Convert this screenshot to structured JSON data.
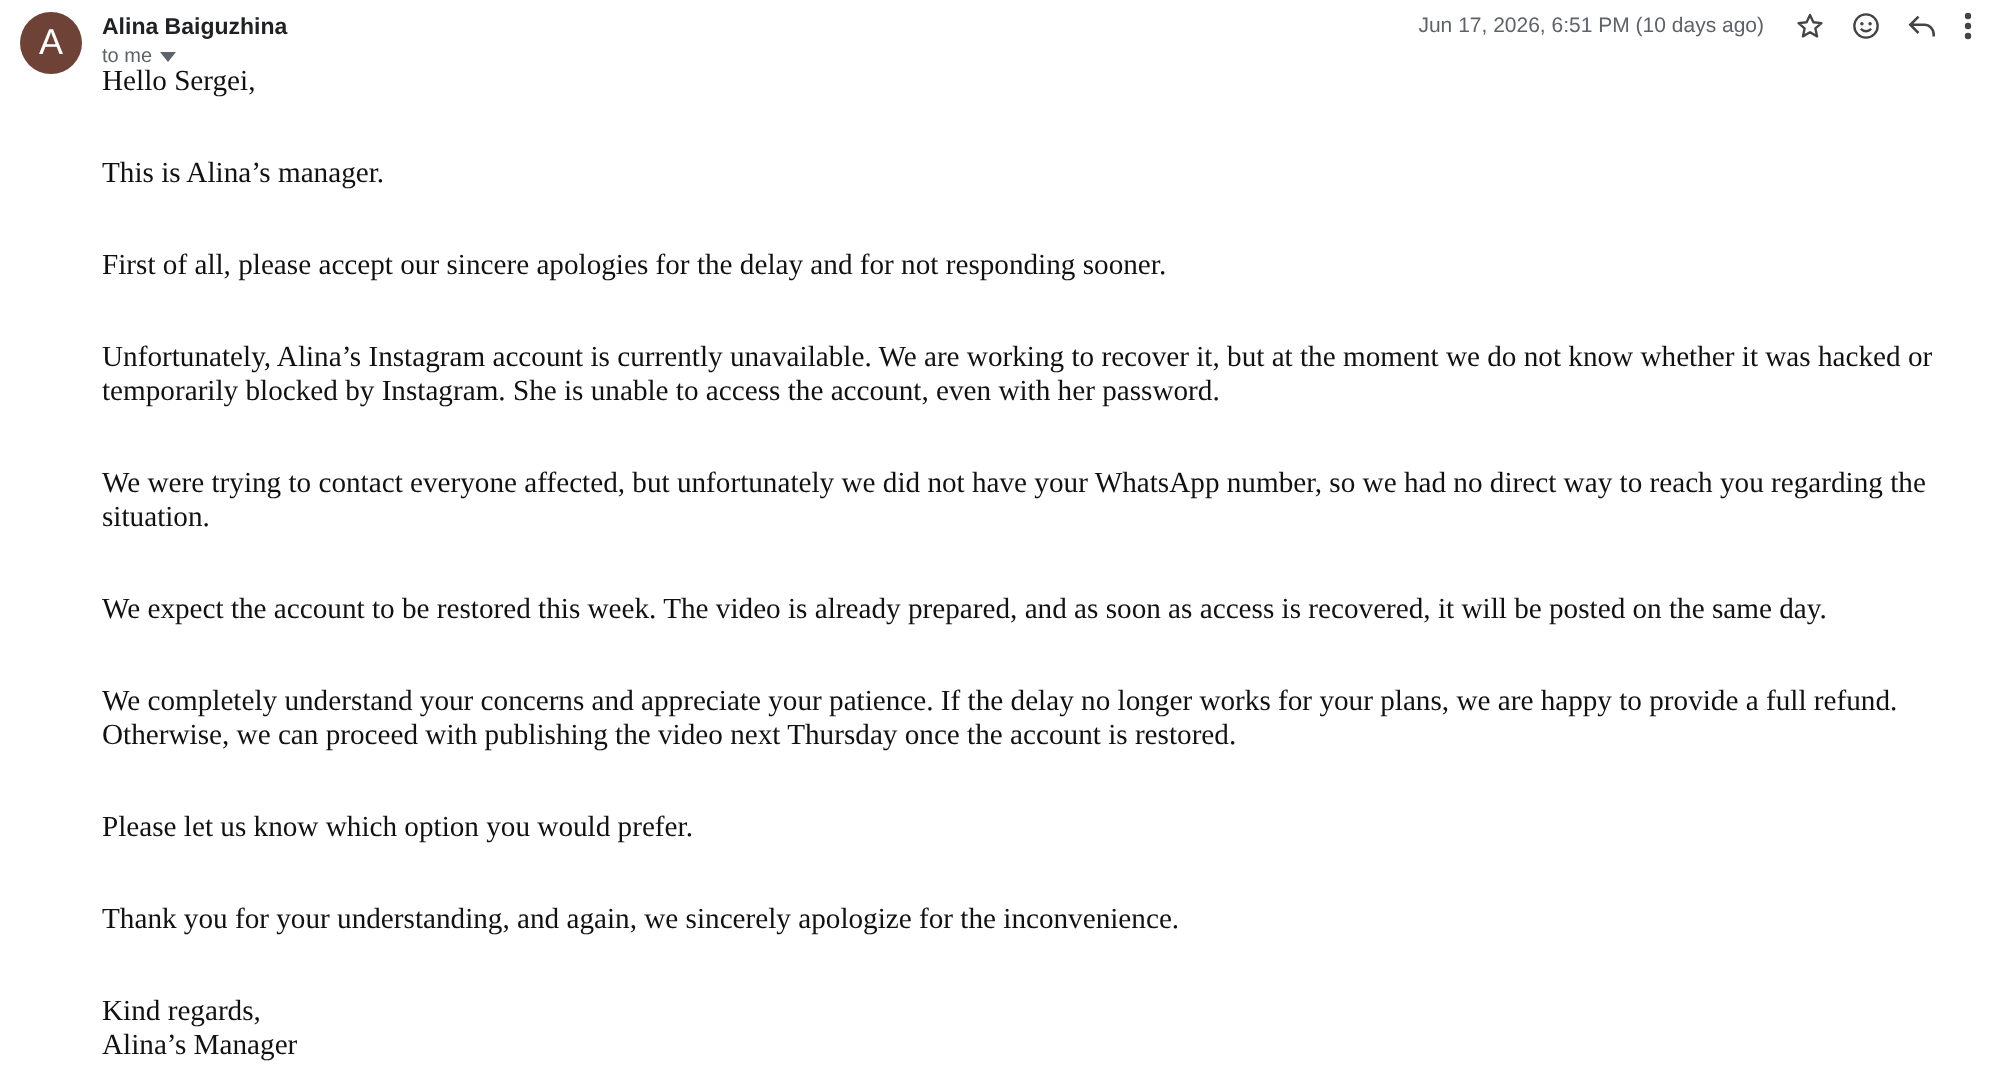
{
  "sender": {
    "avatar_letter": "A",
    "name": "Alina Baiguzhina",
    "recipient": "to me"
  },
  "date": "Jun 17, 2026, 6:51 PM (10 days ago)",
  "starred": false,
  "body": [
    "Hello Sergei,",
    "This is Alina’s manager.",
    "First of all, please accept our sincere apologies for the delay and for not responding sooner.",
    "Unfortunately, Alina’s Instagram account is currently unavailable. We are working to recover it, but at the moment we do not know whether it was hacked or temporarily blocked by Instagram. She is unable to access the account, even with her password.",
    "We were trying to contact everyone affected, but unfortunately we did not have your WhatsApp number, so we had no direct way to reach you regarding the situation.",
    "We expect the account to be restored this week. The video is already prepared, and as soon as access is recovered, it will be posted on the same day.",
    "We completely understand your concerns and appreciate your patience. If the delay no longer works for your plans, we are happy to provide a full refund. Otherwise, we can proceed with publishing the video next Thursday once the account is restored.",
    "Please let us know which option you would prefer.",
    "Thank you for your understanding, and again, we sincerely apologize for the inconvenience."
  ],
  "signoff": [
    "Kind regards,",
    "Alina’s Manager"
  ]
}
